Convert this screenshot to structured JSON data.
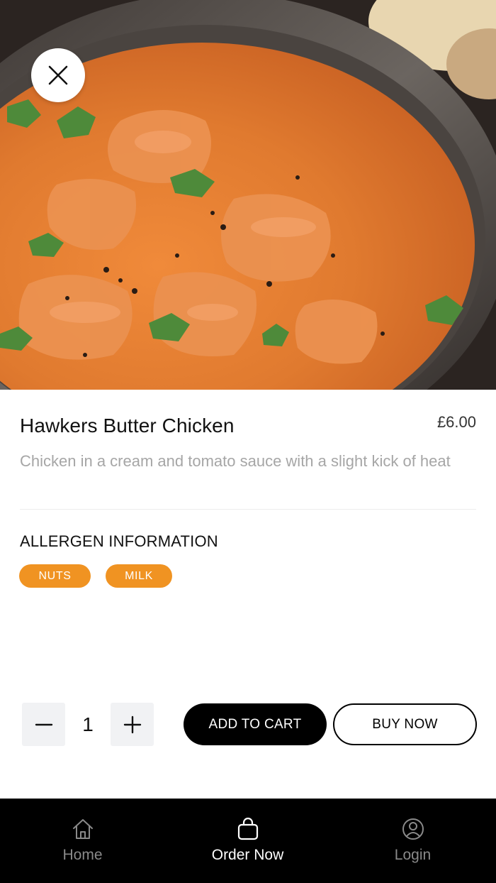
{
  "product": {
    "name": "Hawkers Butter Chicken",
    "price": "£6.00",
    "description": "Chicken in a cream and tomato sauce with a slight kick of heat"
  },
  "allergens": {
    "heading": "ALLERGEN INFORMATION",
    "items": [
      "NUTS",
      "MILK"
    ]
  },
  "quantity": {
    "value": "1"
  },
  "actions": {
    "add_to_cart": "ADD TO CART",
    "buy_now": "BUY NOW"
  },
  "tabbar": {
    "home": "Home",
    "order_now": "Order Now",
    "login": "Login",
    "active_tab": "order_now"
  },
  "icons": {
    "close": "close-icon",
    "minus": "minus-icon",
    "plus": "plus-icon",
    "home": "home-icon",
    "order": "shopping-bag-icon",
    "login": "user-circle-icon"
  },
  "colors": {
    "tag_bg": "#f09322",
    "primary_button": "#000000",
    "tabbar_bg": "#000000",
    "description_text": "#a6a6a6"
  }
}
